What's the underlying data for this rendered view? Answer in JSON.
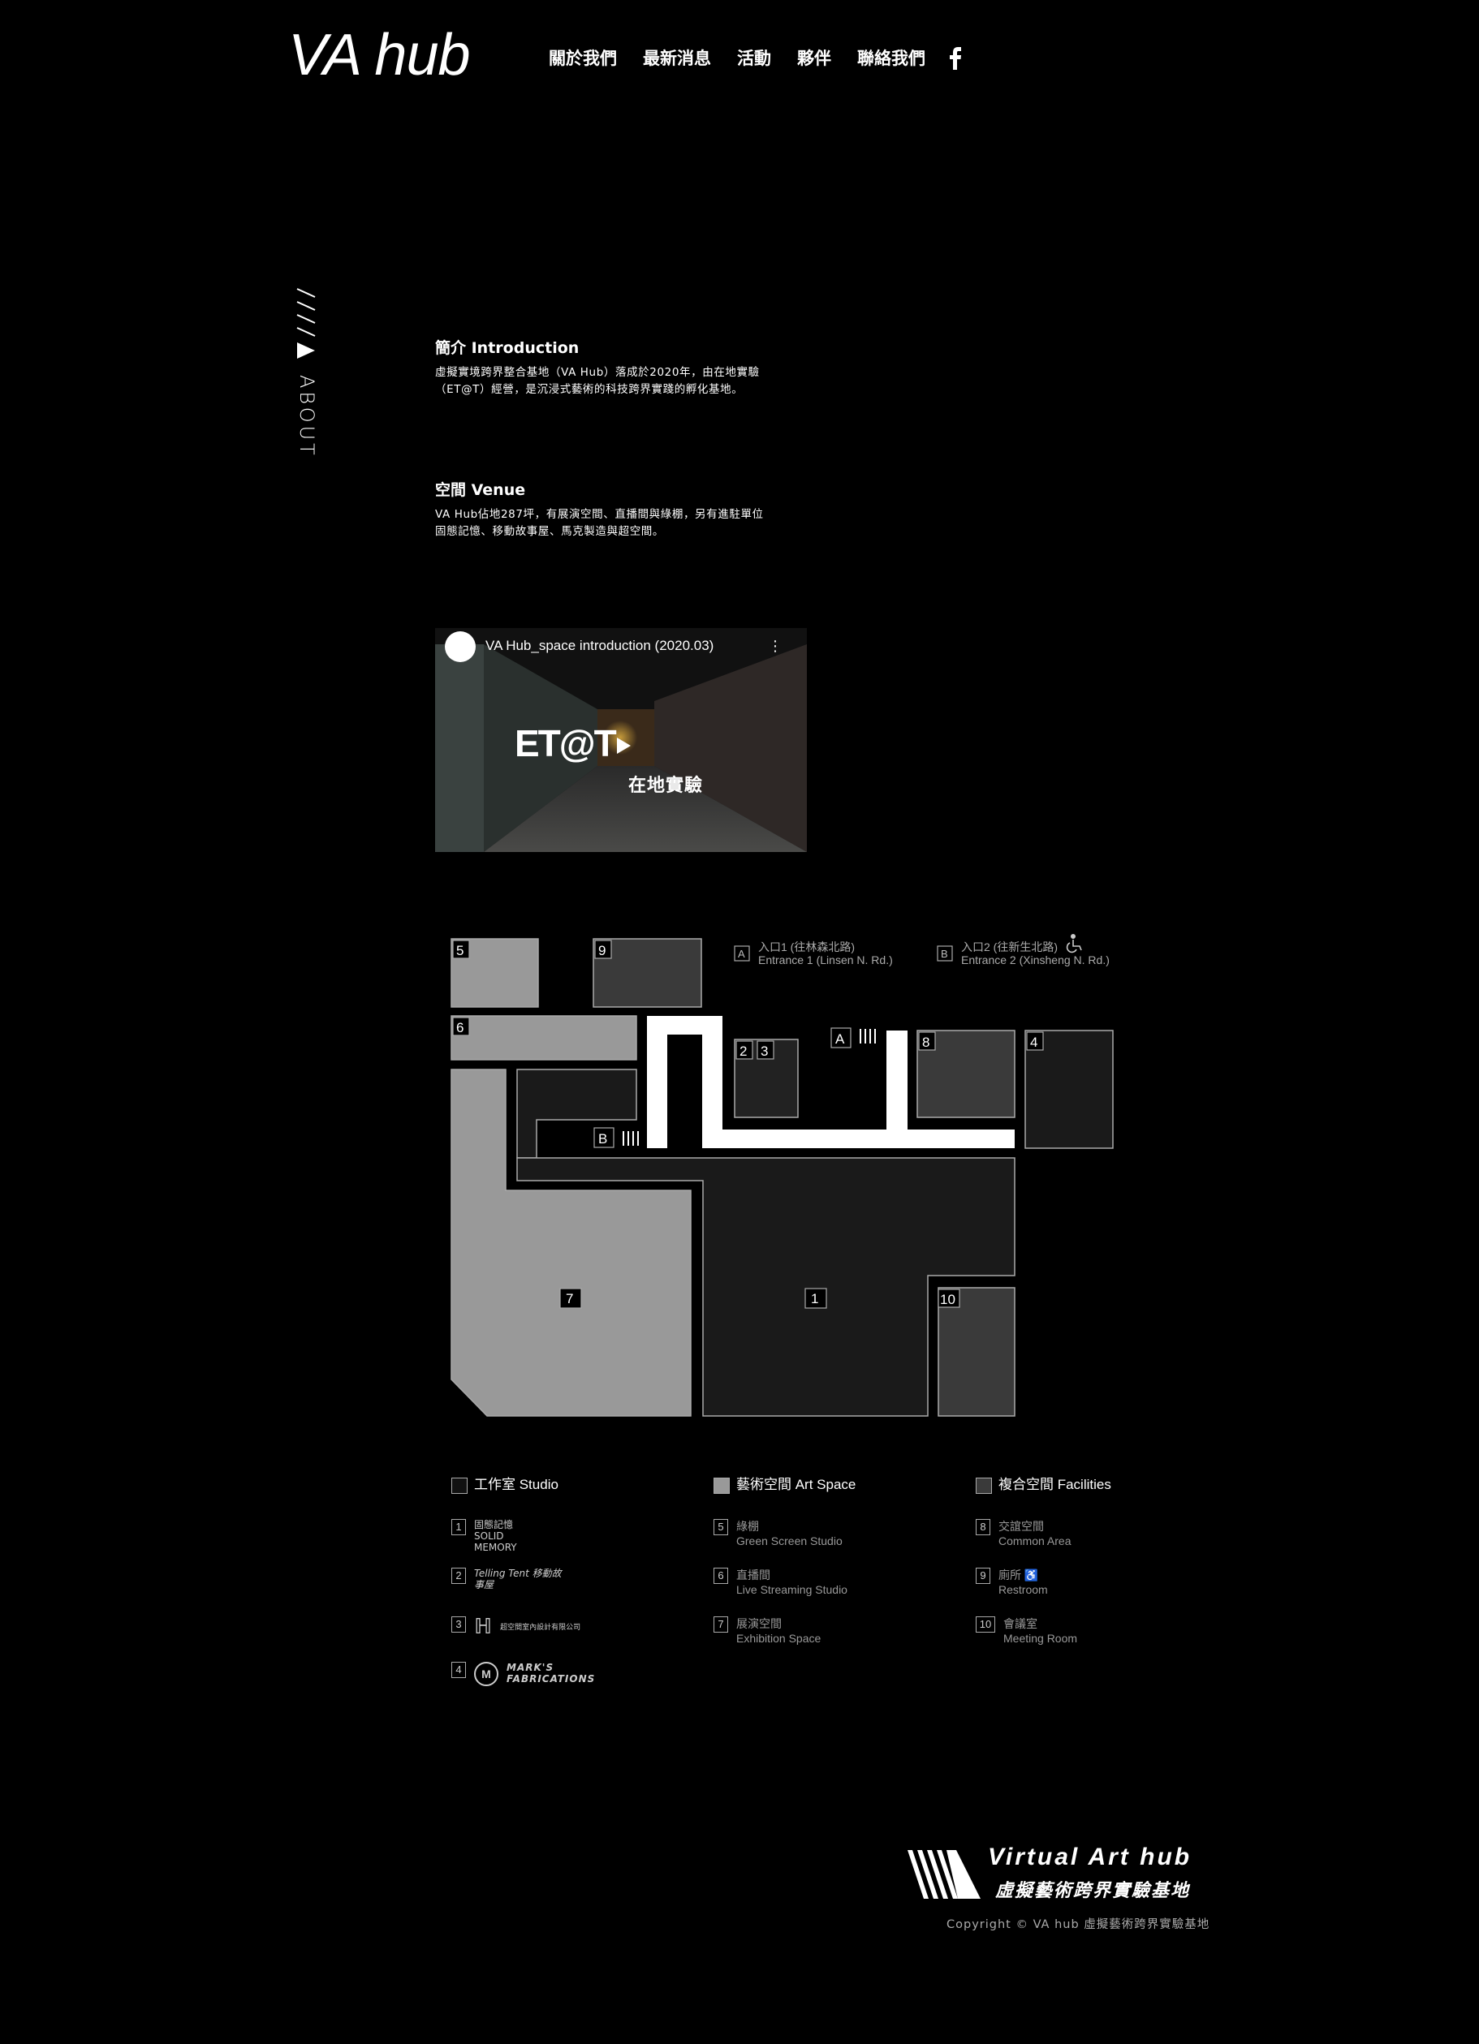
{
  "header": {
    "logo": "VA hub",
    "nav": [
      "關於我們",
      "最新消息",
      "活動",
      "夥伴",
      "聯絡我們"
    ]
  },
  "side_label": {
    "text": "ABOUT"
  },
  "intro": {
    "title": "簡介 Introduction",
    "line1": "虛擬實境跨界整合基地（VA Hub）落成於2020年，由在地實驗",
    "line2": "（ET@T）經營，是沉浸式藝術的科技跨界實踐的孵化基地。"
  },
  "venue": {
    "title": "空間 Venue",
    "line1": "VA Hub佔地287坪，有展演空間、直播間與綠棚，另有進駐單位",
    "line2": "固態記憶、移動故事屋、馬克製造與超空間。"
  },
  "video": {
    "title": "VA Hub_space introduction (2020.03)",
    "overlay_text": "在地實驗",
    "overlay_logo": "ET@T"
  },
  "map": {
    "entrance_a_zh": "入口1 (往林森北路)",
    "entrance_a_en": "Entrance 1 (Linsen N. Rd.)",
    "entrance_b_zh": "入口2 (往新生北路)",
    "entrance_b_en": "Entrance 2 (Xinsheng N. Rd.)",
    "letter_a": "A",
    "letter_b": "B",
    "rooms": [
      "1",
      "2",
      "3",
      "4",
      "5",
      "6",
      "7",
      "8",
      "9",
      "10"
    ]
  },
  "legend": {
    "studio": "工作室 Studio",
    "art": "藝術空間 Art Space",
    "facilities": "複合空間 Facilities",
    "studio_items": [
      {
        "num": "1",
        "brand": "固態記憶 SOLID MEMORY"
      },
      {
        "num": "2",
        "brand": "Telling Tent 移動故事屋"
      },
      {
        "num": "3",
        "brand": "超空間室內設計有限公司"
      },
      {
        "num": "4",
        "brand": "MARK'S FABRICATIONS"
      }
    ],
    "art_items": [
      {
        "num": "5",
        "zh": "綠棚",
        "en": "Green Screen Studio"
      },
      {
        "num": "6",
        "zh": "直播間",
        "en": "Live Streaming Studio"
      },
      {
        "num": "7",
        "zh": "展演空間",
        "en": "Exhibition Space"
      }
    ],
    "fac_items": [
      {
        "num": "8",
        "zh": "交誼空間",
        "en": "Common Area"
      },
      {
        "num": "9",
        "zh": "廁所",
        "en": "Restroom"
      },
      {
        "num": "10",
        "zh": "會議室",
        "en": "Meeting Room"
      }
    ]
  },
  "footer": {
    "brand_en": "Virtual Art hub",
    "brand_zh": "虛擬藝術跨界實驗基地",
    "copyright": "Copyright © VA hub 虛擬藝術跨界實驗基地"
  }
}
